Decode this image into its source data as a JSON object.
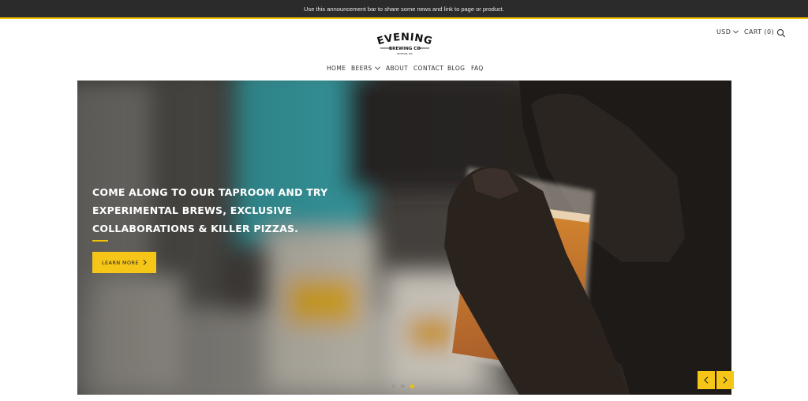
{
  "announcement": {
    "text": "Use this announcement bar to share some news and link to page or product."
  },
  "brand": {
    "name": "EVENING",
    "sub": "BREWING CO",
    "tagline": "BOSTON, MA",
    "accent": "#f2c200"
  },
  "utility": {
    "currency": "USD",
    "cart_label": "CART (0)",
    "search_icon": "search-icon"
  },
  "nav": {
    "items": [
      {
        "label": "HOME"
      },
      {
        "label": "BEERS",
        "has_dropdown": true
      },
      {
        "label": "ABOUT"
      },
      {
        "label": "CONTACT"
      },
      {
        "label": "BLOG"
      },
      {
        "label": "FAQ"
      }
    ]
  },
  "hero": {
    "headline_lines": [
      "COME ALONG TO OUR TAPROOM AND TRY",
      "EXPERIMENTAL BREWS, EXCLUSIVE",
      "COLLABORATIONS & KILLER PIZZAS."
    ],
    "cta_label": "LEARN MORE",
    "slides_total": 3,
    "active_slide": 3
  }
}
